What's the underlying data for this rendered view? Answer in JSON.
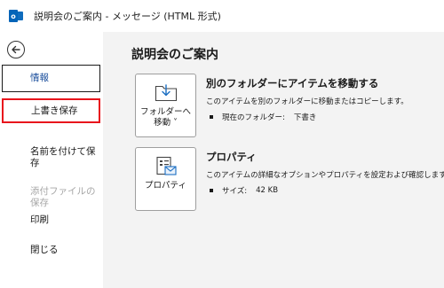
{
  "window": {
    "title": "説明会のご案内 - メッセージ (HTML 形式)",
    "app_icon_letter": "o"
  },
  "sidebar": {
    "back_icon": "arrow-left-circle-icon",
    "items": [
      {
        "label": "情報"
      },
      {
        "label": "上書き保存"
      },
      {
        "label": "名前を付けて保\n存"
      },
      {
        "label": "添付ファイルの\n保存"
      },
      {
        "label": "印刷"
      },
      {
        "label": "閉じる"
      }
    ]
  },
  "main": {
    "title": "説明会のご案内",
    "move": {
      "tile_label": "フォルダーへ\n移動 ˅",
      "title": "別のフォルダーにアイテムを移動する",
      "desc": "このアイテムを別のフォルダーに移動またはコピーします。",
      "bullet_label": "現在のフォルダー:",
      "bullet_value": "下書き"
    },
    "props": {
      "tile_label": "プロパティ",
      "title": "プロパティ",
      "desc": "このアイテムの詳細なオプションやプロパティを設定および確認します。",
      "bullet_label": "サイズ:",
      "bullet_value": "42 KB"
    }
  },
  "colors": {
    "accent_blue": "#1b4f9c",
    "highlight_red": "#e8141c",
    "disabled_gray": "#a6a6a6"
  }
}
